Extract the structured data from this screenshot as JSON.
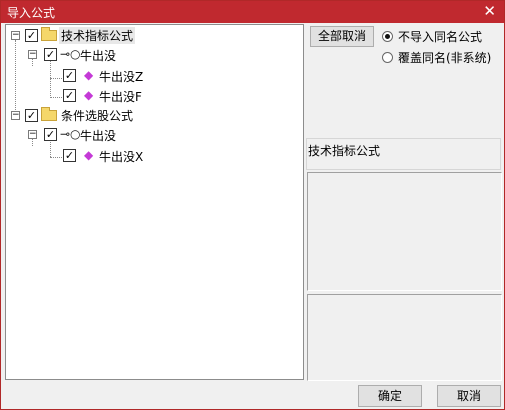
{
  "window": {
    "title": "导入公式",
    "close_glyph": "✕"
  },
  "tree": {
    "nodes": [
      {
        "label": "技术指标公式",
        "expander": "−",
        "checked": "✓",
        "kind": "category"
      },
      {
        "label": "牛出没",
        "expander": "−",
        "checked": "✓",
        "kind": "formula-group"
      },
      {
        "label": "牛出没Z",
        "checked": "✓",
        "kind": "formula"
      },
      {
        "label": "牛出没F",
        "checked": "✓",
        "kind": "formula"
      },
      {
        "label": "条件选股公式",
        "expander": "−",
        "checked": "✓",
        "kind": "category"
      },
      {
        "label": "牛出没",
        "expander": "−",
        "checked": "✓",
        "kind": "formula-group"
      },
      {
        "label": "牛出没X",
        "checked": "✓",
        "kind": "formula"
      }
    ],
    "icons": {
      "folder": "folder-icon",
      "key": "key-icon",
      "formula": "formula-gem-icon"
    },
    "key_glyph": "⊸○",
    "gem_glyph": "◆"
  },
  "options": {
    "cancel_all_label": "全部取消",
    "radio_no_import": "不导入同名公式",
    "radio_overwrite": "覆盖同名(非系统)",
    "selected_option": "no_import"
  },
  "detail": {
    "header": "技术指标公式"
  },
  "footer": {
    "ok_label": "确定",
    "cancel_label": "取消"
  },
  "colors": {
    "titlebar": "#c0292f",
    "gem": "#c43ad6",
    "folder": "#f5d76a"
  }
}
